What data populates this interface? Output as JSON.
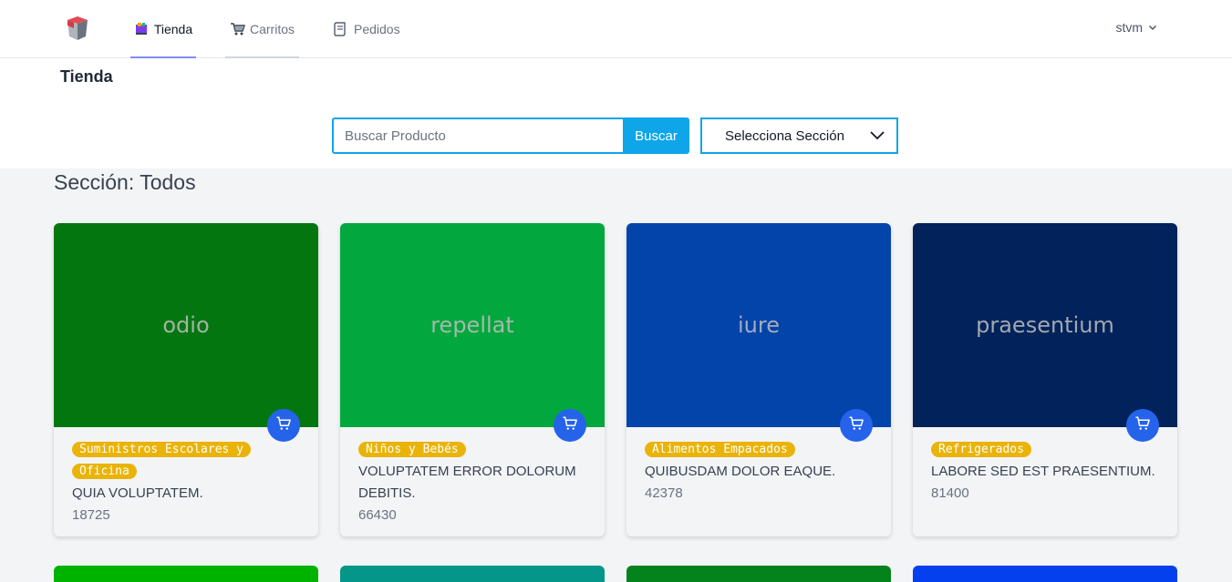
{
  "nav": {
    "items": [
      {
        "label": "Tienda",
        "icon": "shop-icon"
      },
      {
        "label": "Carritos",
        "icon": "cart-icon"
      },
      {
        "label": "Pedidos",
        "icon": "receipt-icon"
      }
    ],
    "user": "stvm"
  },
  "header": {
    "title": "Tienda",
    "search_placeholder": "Buscar Producto",
    "search_button": "Buscar",
    "section_select": "Selecciona Sección"
  },
  "main": {
    "section_heading": "Sección: Todos",
    "products": [
      {
        "image_text": "odio",
        "image_color": "#047610",
        "category": "Suministros Escolares y Oficina",
        "name": "QUIA VOLUPTATEM.",
        "price": "18725"
      },
      {
        "image_text": "repellat",
        "image_color": "#02a73e",
        "category": "Niños y Bebés",
        "name": "VOLUPTATEM ERROR DOLORUM DEBITIS.",
        "price": "66430"
      },
      {
        "image_text": "iure",
        "image_color": "#0344aa",
        "category": "Alimentos Empacados",
        "name": "QUIBUSDAM DOLOR EAQUE.",
        "price": "42378"
      },
      {
        "image_text": "praesentium",
        "image_color": "#01225a",
        "category": "Refrigerados",
        "name": "LABORE SED EST PRAESENTIUM.",
        "price": "81400"
      }
    ],
    "next_row_colors": [
      "#00b300",
      "#049688",
      "#04831c",
      "#0440ee"
    ]
  },
  "colors": {
    "accent": "#0ea5e9",
    "cart_button": "#2563eb",
    "badge": "#eab308",
    "nav_active_underline": "#818cf8"
  }
}
